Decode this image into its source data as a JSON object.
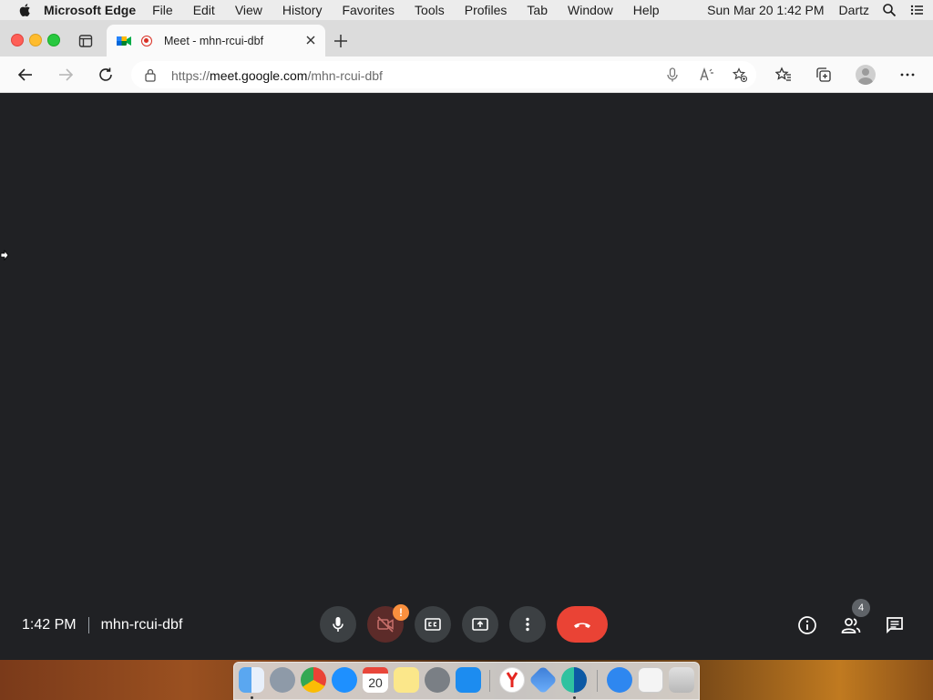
{
  "menubar": {
    "app_name": "Microsoft Edge",
    "menus": [
      "File",
      "Edit",
      "View",
      "History",
      "Favorites",
      "Tools",
      "Profiles",
      "Tab",
      "Window",
      "Help"
    ],
    "clock": "Sun Mar 20  1:42 PM",
    "user": "Dartz"
  },
  "browser": {
    "tab_title": "Meet - mhn-rcui-dbf",
    "url_prefix": "https://",
    "url_host": "meet.google.com",
    "url_path": "/mhn-rcui-dbf"
  },
  "meet": {
    "time": "1:42 PM",
    "meeting_code": "mhn-rcui-dbf",
    "camera_warning": "!",
    "participant_count": "4"
  },
  "dock": {
    "calendar_day": "20",
    "apps": [
      "Finder",
      "Launchpad",
      "Google Chrome",
      "Safari",
      "Calendar",
      "Notes",
      "System Preferences",
      "App Store",
      "Yandex",
      "Mercury",
      "Microsoft Edge",
      "App Store Downloads",
      "Scanner",
      "Trash"
    ]
  },
  "colors": {
    "meet_background": "#202124",
    "control_button": "#3c4043",
    "hangup": "#ea4335",
    "camera_off": "#5c2b29",
    "warning": "#fa903e"
  }
}
